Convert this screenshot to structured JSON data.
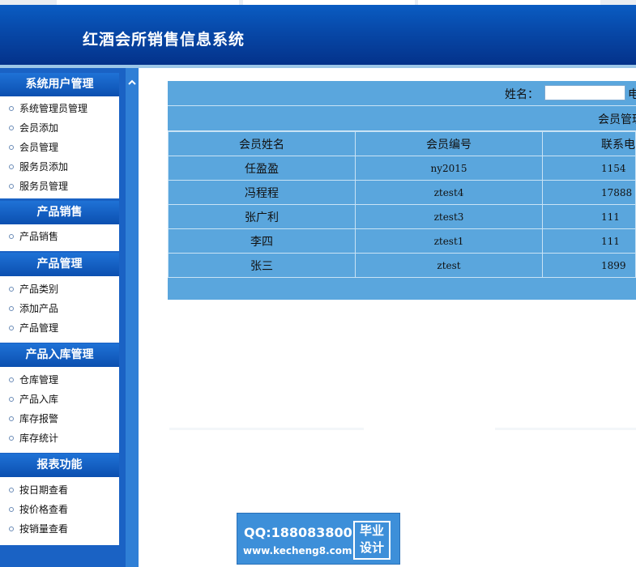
{
  "app": {
    "title": "红酒会所销售信息系统"
  },
  "sidebar": {
    "groups": [
      {
        "title": "系统用户管理",
        "items": [
          "系统管理员管理",
          "会员添加",
          "会员管理",
          "服务员添加",
          "服务员管理"
        ]
      },
      {
        "title": "产品销售",
        "items": [
          "产品销售"
        ]
      },
      {
        "title": "产品管理",
        "items": [
          "产品类别",
          "添加产品",
          "产品管理"
        ]
      },
      {
        "title": "产品入库管理",
        "items": [
          "仓库管理",
          "产品入库",
          "库存报警",
          "库存统计"
        ]
      },
      {
        "title": "报表功能",
        "items": [
          "按日期查看",
          "按价格查看",
          "按销量查看"
        ]
      }
    ],
    "collapse_icon": "chevron-up-icon"
  },
  "search": {
    "label": "姓名：",
    "value": "",
    "tail": "电"
  },
  "table": {
    "title": "会员管理",
    "columns": [
      "会员姓名",
      "会员编号",
      "联系电"
    ],
    "rows": [
      [
        "任盈盈",
        "ny2015",
        "1154"
      ],
      [
        "冯程程",
        "ztest4",
        "17888"
      ],
      [
        "张广利",
        "ztest3",
        "111"
      ],
      [
        "李四",
        "ztest1",
        "111"
      ],
      [
        "张三",
        "ztest",
        "1899"
      ]
    ]
  },
  "watermark": {
    "qq": "QQ:188083800",
    "url": "www.kecheng8.com",
    "badge_top": "毕业",
    "badge_bottom": "设计"
  },
  "colors": {
    "header": "#0748a8",
    "sidebar": "#1a62c4",
    "panel": "#5aa6dd"
  }
}
